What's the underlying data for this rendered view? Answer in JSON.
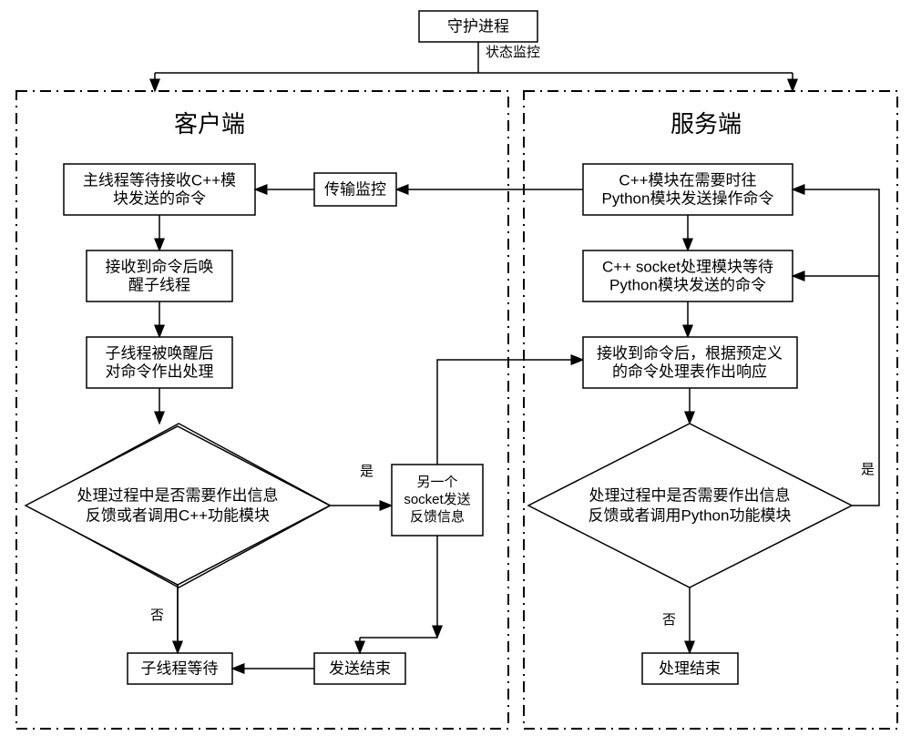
{
  "top": {
    "guard": "守护进程",
    "status_monitor": "状态监控"
  },
  "client": {
    "title": "客户端",
    "c1_l1": "主线程等待接收C++模",
    "c1_l2": "块发送的命令",
    "trans_monitor": "传输监控",
    "c2_l1": "接收到命令后唤",
    "c2_l2": "醒子线程",
    "c3_l1": "子线程被唤醒后",
    "c3_l2": "对命令作出处理",
    "d1_l1": "处理过程中是否需要作出信息",
    "d1_l2": "反馈或者调用C++功能模块",
    "yes": "是",
    "no": "否",
    "sock_l1": "另一个",
    "sock_l2": "socket发送",
    "sock_l3": "反馈信息",
    "wait": "子线程等待",
    "send_end": "发送结束"
  },
  "server": {
    "title": "服务端",
    "s1_l1": "C++模块在需要时往",
    "s1_l2": "Python模块发送操作命令",
    "s2_l1": "C++ socket处理模块等待",
    "s2_l2": "Python模块发送的命令",
    "s3_l1": "接收到命令后，根据预定义",
    "s3_l2": "的命令处理表作出响应",
    "d2_l1": "处理过程中是否需要作出信息",
    "d2_l2": "反馈或者调用Python功能模块",
    "yes": "是",
    "no": "否",
    "end": "处理结束"
  }
}
